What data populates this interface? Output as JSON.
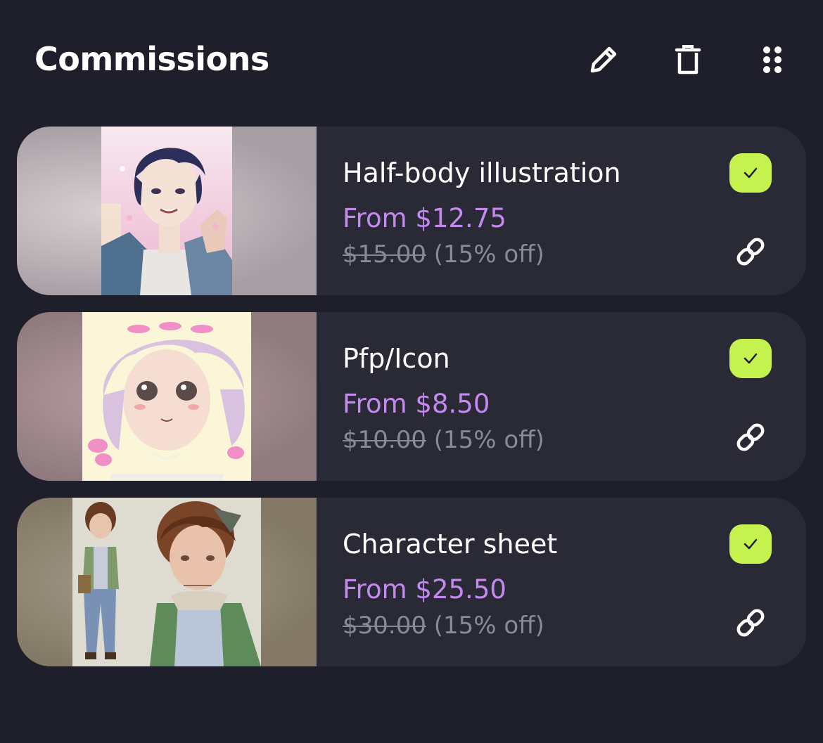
{
  "header": {
    "title": "Commissions",
    "icons": [
      "pencil-icon",
      "trash-icon",
      "grid-dots-icon"
    ]
  },
  "commissions": [
    {
      "title": "Half-body illustration",
      "price": "From $12.75",
      "old_price": "$15.00",
      "discount": "(15% off)",
      "selected": true,
      "thumb_bg": "#b7acb0",
      "art_bg": "#f2d6e2"
    },
    {
      "title": "Pfp/Icon",
      "price": "From $8.50",
      "old_price": "$10.00",
      "discount": "(15% off)",
      "selected": true,
      "thumb_bg": "#9e8488",
      "art_bg": "#fbf6d8"
    },
    {
      "title": "Character sheet",
      "price": "From $25.50",
      "old_price": "$30.00",
      "discount": "(15% off)",
      "selected": true,
      "thumb_bg": "#8b8170",
      "art_bg": "#dedbd0"
    }
  ],
  "colors": {
    "background": "#1f1f2b",
    "card": "#2a2a37",
    "price": "#c58af0",
    "old_price": "#8a8a96",
    "check": "#c6f24f"
  }
}
